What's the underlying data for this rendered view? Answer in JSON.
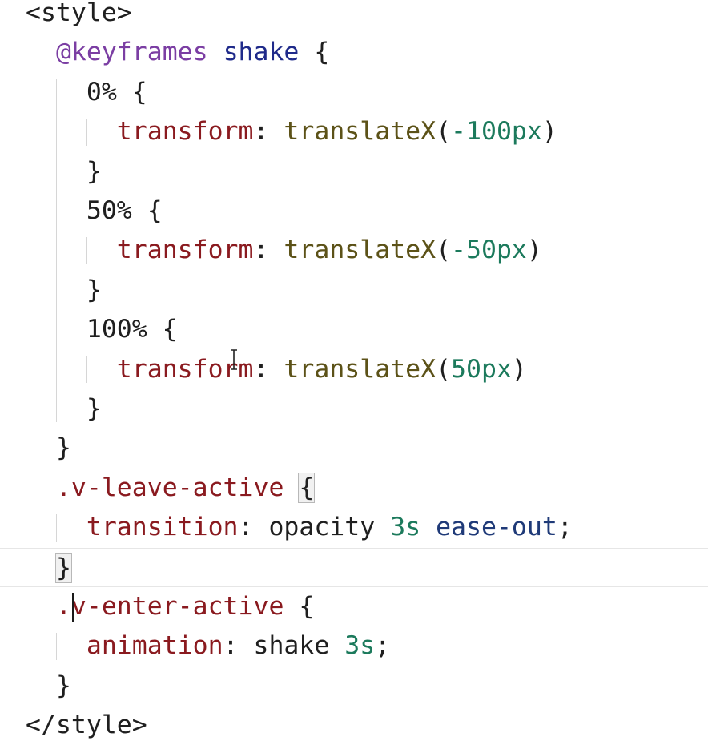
{
  "colors": {
    "background": "#ffffff",
    "punctuation": "#1f1f1f",
    "at_rule": "#7b3ea3",
    "animation_name": "#1f2a8a",
    "property": "#8a1a1f",
    "function": "#5c5218",
    "number": "#1c7a5c",
    "keyword": "#1f3a78",
    "guide": "#d6d6d6",
    "current_line_border": "#e6e6e6"
  },
  "cursor": {
    "icon": "text-ibeam-cursor-icon",
    "caret_line": 15
  },
  "lines": [
    {
      "tokens": [
        {
          "t": "<style>",
          "c": "tag"
        }
      ]
    },
    {
      "tokens": [
        {
          "t": "  "
        },
        {
          "t": "@keyframes",
          "c": "at"
        },
        {
          "t": " "
        },
        {
          "t": "shake",
          "c": "name"
        },
        {
          "t": " {",
          "c": "punct"
        }
      ]
    },
    {
      "tokens": [
        {
          "t": "    "
        },
        {
          "t": "0%",
          "c": "sel"
        },
        {
          "t": " {",
          "c": "punct"
        }
      ]
    },
    {
      "tokens": [
        {
          "t": "      "
        },
        {
          "t": "transform",
          "c": "prop"
        },
        {
          "t": ": ",
          "c": "punct"
        },
        {
          "t": "translateX",
          "c": "fn"
        },
        {
          "t": "(",
          "c": "punct"
        },
        {
          "t": "-100px",
          "c": "num"
        },
        {
          "t": ")",
          "c": "punct"
        }
      ]
    },
    {
      "tokens": [
        {
          "t": "    "
        },
        {
          "t": "}",
          "c": "punct"
        }
      ]
    },
    {
      "tokens": [
        {
          "t": "    "
        },
        {
          "t": "50%",
          "c": "sel"
        },
        {
          "t": " {",
          "c": "punct"
        }
      ]
    },
    {
      "tokens": [
        {
          "t": "      "
        },
        {
          "t": "transform",
          "c": "prop"
        },
        {
          "t": ": ",
          "c": "punct"
        },
        {
          "t": "translateX",
          "c": "fn"
        },
        {
          "t": "(",
          "c": "punct"
        },
        {
          "t": "-50px",
          "c": "num"
        },
        {
          "t": ")",
          "c": "punct"
        }
      ]
    },
    {
      "tokens": [
        {
          "t": "    "
        },
        {
          "t": "}",
          "c": "punct"
        }
      ]
    },
    {
      "tokens": [
        {
          "t": "    "
        },
        {
          "t": "100%",
          "c": "sel"
        },
        {
          "t": " {",
          "c": "punct"
        }
      ]
    },
    {
      "tokens": [
        {
          "t": "      "
        },
        {
          "t": "transform",
          "c": "prop"
        },
        {
          "t": ": ",
          "c": "punct"
        },
        {
          "t": "translateX",
          "c": "fn"
        },
        {
          "t": "(",
          "c": "punct"
        },
        {
          "t": "50px",
          "c": "num"
        },
        {
          "t": ")",
          "c": "punct"
        }
      ]
    },
    {
      "tokens": [
        {
          "t": "    "
        },
        {
          "t": "}",
          "c": "punct"
        }
      ]
    },
    {
      "tokens": [
        {
          "t": "  "
        },
        {
          "t": "}",
          "c": "punct"
        }
      ]
    },
    {
      "tokens": [
        {
          "t": "  "
        },
        {
          "t": ".v-leave-active",
          "c": "prop"
        },
        {
          "t": " "
        },
        {
          "t": "{",
          "c": "punct",
          "match": true
        }
      ]
    },
    {
      "tokens": [
        {
          "t": "    "
        },
        {
          "t": "transition",
          "c": "prop"
        },
        {
          "t": ": ",
          "c": "punct"
        },
        {
          "t": "opacity",
          "c": "val"
        },
        {
          "t": " "
        },
        {
          "t": "3s",
          "c": "num"
        },
        {
          "t": " "
        },
        {
          "t": "ease-out",
          "c": "kw"
        },
        {
          "t": ";",
          "c": "punct"
        }
      ]
    },
    {
      "tokens": [
        {
          "t": "  "
        },
        {
          "t": "}",
          "c": "punct",
          "match": true
        }
      ],
      "current": true
    },
    {
      "tokens": [
        {
          "t": "  "
        },
        {
          "t": ".v-enter-active",
          "c": "prop"
        },
        {
          "t": " {",
          "c": "punct"
        }
      ]
    },
    {
      "tokens": [
        {
          "t": "    "
        },
        {
          "t": "animation",
          "c": "prop"
        },
        {
          "t": ": ",
          "c": "punct"
        },
        {
          "t": "shake",
          "c": "val"
        },
        {
          "t": " "
        },
        {
          "t": "3s",
          "c": "num"
        },
        {
          "t": ";",
          "c": "punct"
        }
      ]
    },
    {
      "tokens": [
        {
          "t": "  "
        },
        {
          "t": "}",
          "c": "punct"
        }
      ]
    },
    {
      "tokens": [
        {
          "t": "</style>",
          "c": "tag"
        }
      ]
    }
  ]
}
